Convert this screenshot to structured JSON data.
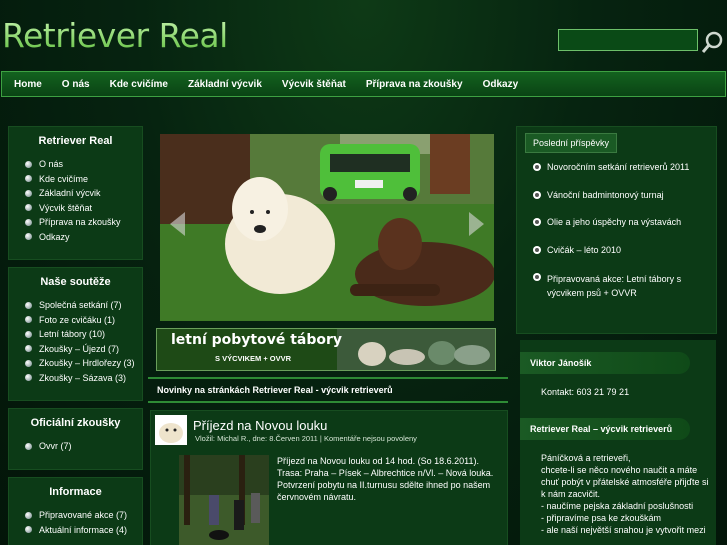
{
  "site": {
    "title": "Retriever Real"
  },
  "search": {
    "value": ""
  },
  "nav": [
    "Home",
    "O nás",
    "Kde cvičíme",
    "Základní výcvik",
    "Výcvik štěňat",
    "Příprava na zkoušky",
    "Odkazy"
  ],
  "sidebar": {
    "main": {
      "title": "Retriever Real",
      "items": [
        "O nás",
        "Kde cvičíme",
        "Základní výcvik",
        "Výcvik štěňat",
        "Příprava na zkoušky",
        "Odkazy"
      ]
    },
    "contests": {
      "title": "Naše soutěže",
      "items": [
        "Společná setkání (7)",
        "Foto ze cvičáku (1)",
        "Letní tábory (10)",
        "Zkoušky – Újezd (7)",
        "Zkoušky – Hrdlořezy (3)",
        "Zkoušky – Sázava (3)"
      ]
    },
    "exams": {
      "title": "Oficiální zkoušky",
      "items": [
        "Ovvr (7)"
      ]
    },
    "info": {
      "title": "Informace",
      "items": [
        "Připravované akce (7)",
        "Aktuální informace (4)"
      ]
    }
  },
  "banner": {
    "text_main": "letní pobytové tábory",
    "text_sub": "S VÝCVIKEM + OVVR"
  },
  "news": {
    "heading": "Novinky na stránkách Retriever Real - výcvik retrieverů"
  },
  "post": {
    "title": "Příjezd na Novou louku",
    "meta": "Vložil: Michal R., dne: 8.Červen 2011 | Komentáře nejsou povoleny",
    "lines": [
      "Příjezd na Novou louku od 14 hod.  (So 18.6.2011).",
      "Trasa: Praha – Písek – Albrechtice n/Vl. – Nová louka.",
      "Potvrzení pobytu na II.turnusu sdělte ihned po našem",
      "červnovém návratu."
    ]
  },
  "recent": {
    "tab": "Poslední příspěvky",
    "items": [
      [
        "Novoročním setkání retrieverů 2011"
      ],
      [
        "Vánoční badmintonový turnaj"
      ],
      [
        "Olie a jeho úspěchy na výstavách"
      ],
      [
        "Cvičák – léto 2010"
      ],
      [
        "Připravovaná akce: Letní tábory s",
        "výcvikem psů + OVVR"
      ]
    ]
  },
  "contact": {
    "name": "Viktor Jánošík",
    "phone": "Kontakt: 603 21 79 21"
  },
  "about": {
    "title": "Retriever Real – výcvik retrieverů",
    "lines": [
      "Páníčková a retrieveři,",
      "chcete-li se něco nového naučit a máte",
      "chuť pobýt v přátelské atmosféře přijďte si",
      "k nám zacvičit.",
      "- naučíme pejska základní poslušnosti",
      "- připravíme psa ke zkouškám",
      "- ale naší největší snahou je vytvořit mezi"
    ]
  },
  "colors": {
    "bg": "#062310",
    "panel": "#0c3a16",
    "accent": "#3da142"
  }
}
